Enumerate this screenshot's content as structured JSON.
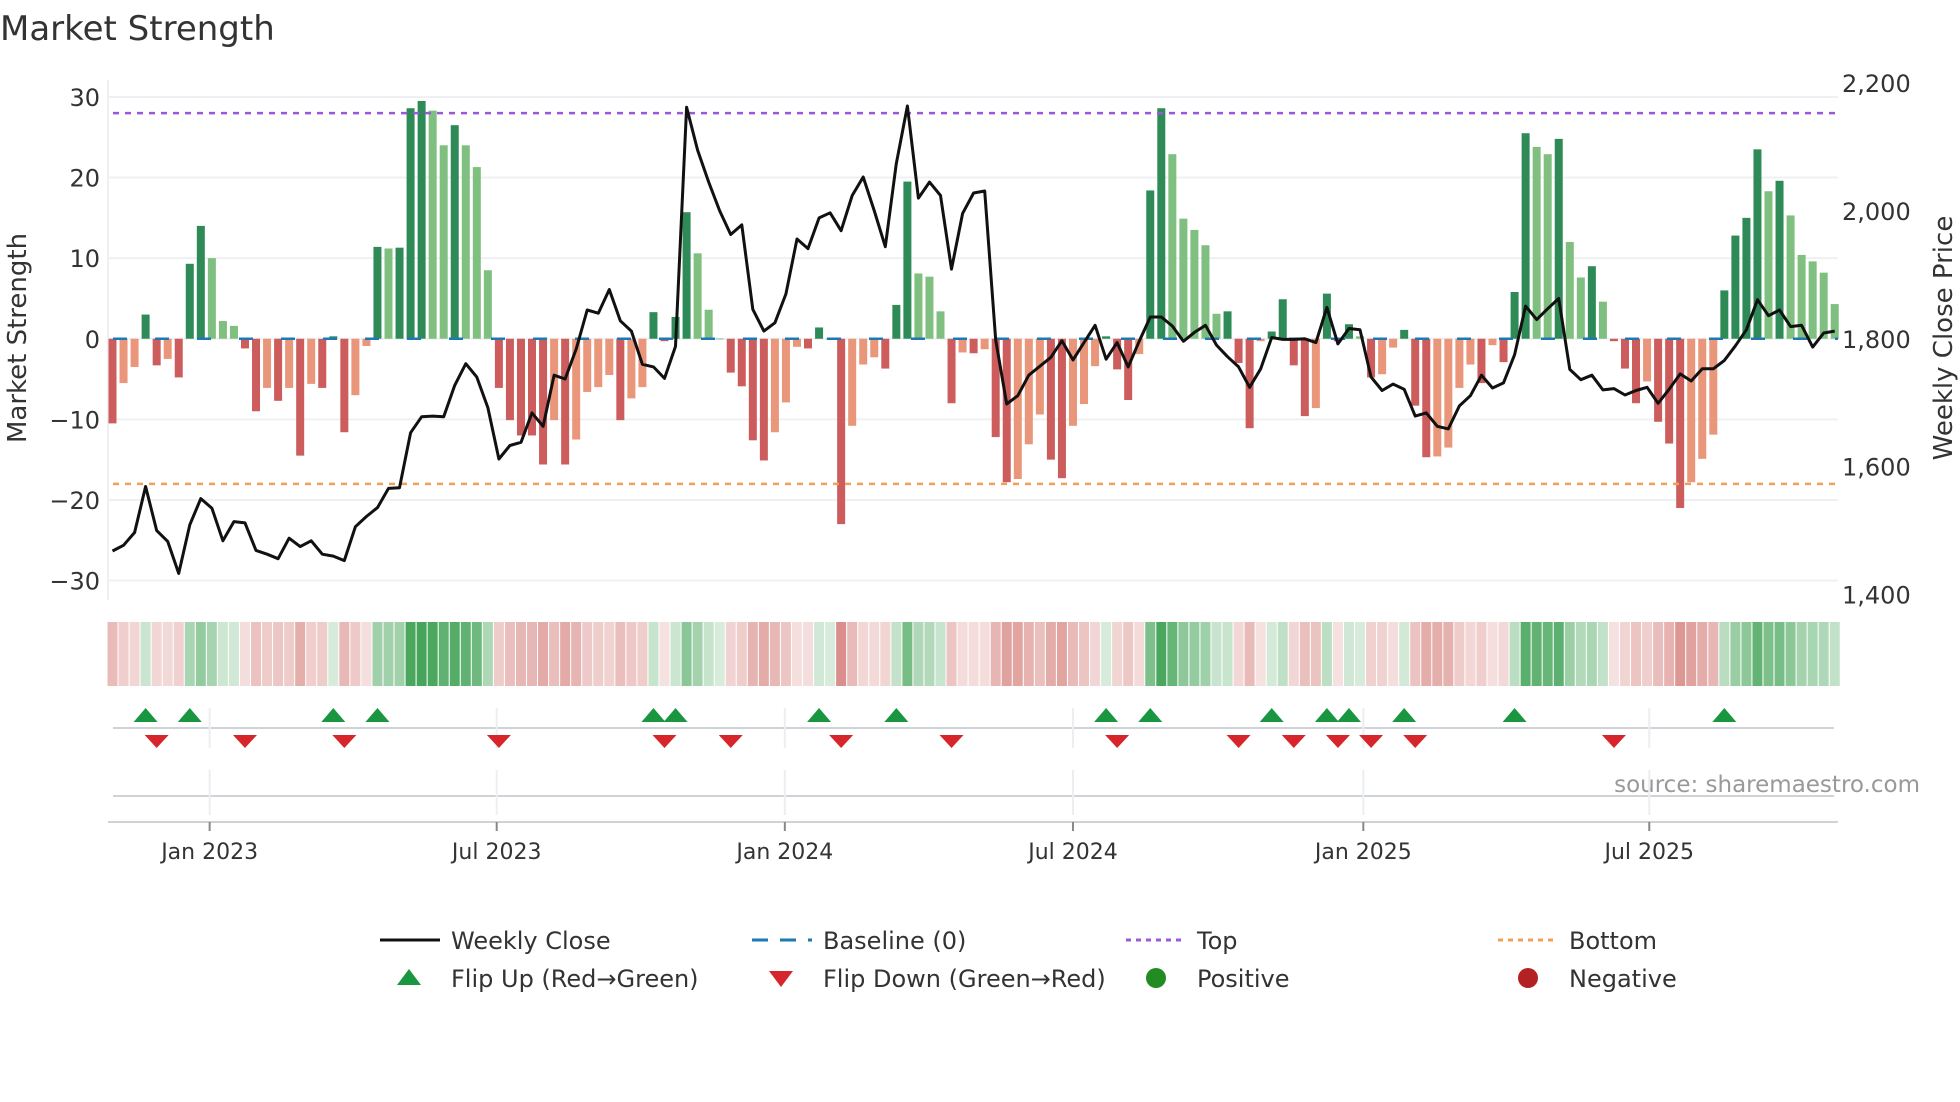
{
  "chart_data": {
    "type": "bar",
    "title": "Market Strength",
    "ylabel": "Market Strength",
    "y2label": "Weekly Close Price",
    "ylim": [
      -32,
      32
    ],
    "y2lim": [
      1400,
      2200
    ],
    "yticks": [
      30,
      20,
      10,
      0,
      -10,
      -20,
      -30
    ],
    "ytick_labels": [
      "30",
      "20",
      "10",
      "0",
      "−10",
      "−20",
      "−30"
    ],
    "y2ticks": [
      2200,
      2000,
      1800,
      1600,
      1400
    ],
    "y2tick_labels": [
      "2,200",
      "2,000",
      "1,800",
      "1,600",
      "1,400"
    ],
    "xticks": [
      8.8,
      34.8,
      60.9,
      87.0,
      113.3,
      139.2
    ],
    "xtick_labels": [
      "Jan 2023",
      "Jul 2023",
      "Jan 2024",
      "Jul 2024",
      "Jan 2025",
      "Jul 2025"
    ],
    "top_level": 28,
    "bottom_level": -18,
    "baseline": 0,
    "strength": [
      -10.5,
      -5.5,
      -3.5,
      3,
      -3.3,
      -2.5,
      -4.8,
      9.3,
      14,
      10,
      2.2,
      1.6,
      -1.2,
      -9,
      -6.1,
      -7.7,
      -6.1,
      -14.5,
      -5.6,
      -6.1,
      0.3,
      -11.6,
      -7,
      -0.9,
      11.4,
      11.2,
      11.3,
      28.6,
      29.5,
      28.3,
      24,
      26.5,
      24,
      21.3,
      8.5,
      -6.1,
      -10.1,
      -12,
      -12,
      -15.6,
      -10.1,
      -15.6,
      -12.5,
      -6.6,
      -6,
      -4.5,
      -10.1,
      -7.4,
      -6,
      3.3,
      -0.3,
      2.7,
      15.7,
      10.6,
      3.6,
      0,
      -4.2,
      -5.9,
      -12.6,
      -15.1,
      -11.6,
      -7.9,
      -1,
      -1.2,
      1.4,
      0,
      -23,
      -10.8,
      -3.2,
      -2.3,
      -3.7,
      4.2,
      19.5,
      8.1,
      7.7,
      3.4,
      -8,
      -1.7,
      -1.8,
      -1.3,
      -12.2,
      -17.8,
      -17.4,
      -13.1,
      -9.4,
      -15,
      -17.3,
      -10.8,
      -8.1,
      -3.4,
      0.3,
      -3.8,
      -7.6,
      -1.9,
      18.4,
      28.6,
      22.9,
      14.9,
      13.5,
      11.6,
      3.1,
      3.4,
      -3,
      -11.1,
      -0.3,
      0.9,
      4.9,
      -3.3,
      -9.6,
      -8.6,
      5.6,
      -0.3,
      1.8,
      0.3,
      -4.8,
      -4.4,
      -1.1,
      1.1,
      -8.3,
      -14.7,
      -14.6,
      -13.5,
      -6.1,
      -3.2,
      -5.5,
      -0.8,
      -2.9,
      5.8,
      25.5,
      23.8,
      22.9,
      24.8,
      12,
      7.6,
      9,
      4.6,
      -0.3,
      -3.7,
      -8,
      -5.3,
      -10.3,
      -13,
      -21,
      -17.8,
      -14.9,
      -11.9,
      6,
      12.8,
      15,
      23.5,
      18.3,
      19.6,
      15.3,
      10.4,
      9.6,
      8.2,
      4.3
    ],
    "weekly_close": [
      1468,
      1477,
      1497,
      1569,
      1500,
      1483,
      1433,
      1509,
      1550,
      1535,
      1484,
      1514,
      1512,
      1469,
      1463,
      1456,
      1488,
      1475,
      1484,
      1463,
      1460,
      1453,
      1506,
      1522,
      1536,
      1566,
      1567,
      1653,
      1678,
      1679,
      1678,
      1727,
      1761,
      1740,
      1692,
      1612,
      1633,
      1638,
      1684,
      1663,
      1743,
      1737,
      1784,
      1845,
      1840,
      1877,
      1828,
      1812,
      1760,
      1756,
      1738,
      1788,
      2162,
      2095,
      2045,
      2000,
      1963,
      1978,
      1846,
      1812,
      1825,
      1870,
      1956,
      1941,
      1989,
      1997,
      1969,
      2024,
      2053,
      2000,
      1944,
      2074,
      2164,
      2020,
      2045,
      2024,
      1909,
      1996,
      2028,
      2031,
      1798,
      1698,
      1711,
      1743,
      1757,
      1771,
      1797,
      1767,
      1794,
      1821,
      1768,
      1794,
      1756,
      1796,
      1834,
      1834,
      1820,
      1796,
      1810,
      1821,
      1790,
      1772,
      1756,
      1724,
      1753,
      1802,
      1799,
      1799,
      1800,
      1794,
      1849,
      1792,
      1816,
      1814,
      1740,
      1719,
      1729,
      1721,
      1679,
      1684,
      1663,
      1659,
      1695,
      1711,
      1743,
      1723,
      1731,
      1775,
      1851,
      1830,
      1847,
      1863,
      1752,
      1736,
      1743,
      1720,
      1722,
      1712,
      1719,
      1724,
      1699,
      1721,
      1745,
      1734,
      1753,
      1753,
      1766,
      1789,
      1814,
      1861,
      1836,
      1845,
      1819,
      1821,
      1787,
      1809,
      1812
    ],
    "legend": {
      "placement": "bottom",
      "items": [
        {
          "label": "Weekly Close",
          "kind": "line"
        },
        {
          "label": "Baseline (0)",
          "kind": "dash"
        },
        {
          "label": "Top",
          "kind": "dot"
        },
        {
          "label": "Bottom",
          "kind": "dot2"
        },
        {
          "label": "Flip Up (Red→Green)",
          "kind": "up"
        },
        {
          "label": "Flip Down (Green→Red)",
          "kind": "down"
        },
        {
          "label": "Positive",
          "kind": "pos"
        },
        {
          "label": "Negative",
          "kind": "neg"
        }
      ]
    },
    "source": "source: sharemaestro.com",
    "colors": {
      "strong_green": "#2e8b57",
      "weak_green": "#7fbf7f",
      "strong_red": "#cd5c5c",
      "weak_red": "#e9967a",
      "close": "#111111",
      "baseline": "#1f77b4",
      "top": "#9b59d6",
      "bottom": "#f0a05a",
      "flip_up": "#1a9641",
      "flip_down": "#d7262b",
      "positive": "#228b22",
      "negative": "#b22222"
    }
  }
}
